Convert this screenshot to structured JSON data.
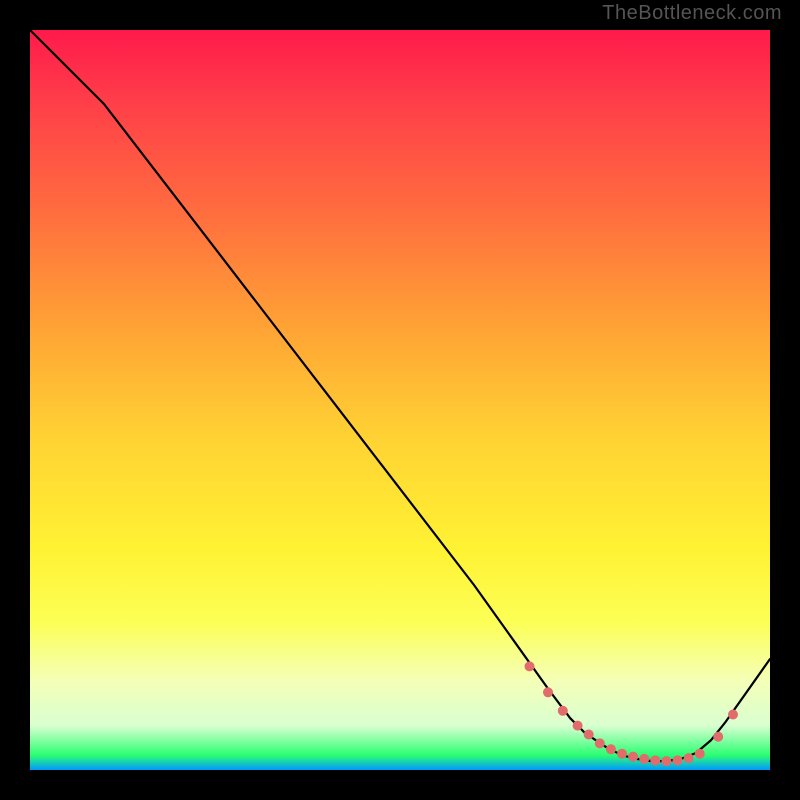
{
  "watermark": "TheBottleneck.com",
  "chart_data": {
    "type": "line",
    "title": "",
    "xlabel": "",
    "ylabel": "",
    "xlim": [
      0,
      100
    ],
    "ylim": [
      0,
      100
    ],
    "curve": {
      "x": [
        0,
        3,
        10,
        20,
        30,
        40,
        50,
        60,
        65,
        70,
        73,
        75,
        78,
        80,
        82,
        84,
        86,
        88,
        90,
        92,
        94,
        100
      ],
      "y": [
        100,
        97,
        90,
        77,
        64,
        51,
        38,
        25,
        18,
        11,
        7,
        5,
        3,
        2,
        1.5,
        1.2,
        1.2,
        1.5,
        2.3,
        4,
        6.5,
        15
      ]
    },
    "markers": {
      "x": [
        67.5,
        70,
        72,
        74,
        75.5,
        77,
        78.5,
        80,
        81.5,
        83,
        84.5,
        86,
        87.5,
        89,
        90.5,
        93,
        95
      ],
      "y": [
        14,
        10.5,
        8,
        6,
        4.8,
        3.6,
        2.8,
        2.2,
        1.8,
        1.5,
        1.3,
        1.2,
        1.3,
        1.6,
        2.2,
        4.5,
        7.5
      ]
    },
    "grid": false,
    "legend": false
  },
  "colors": {
    "curve": "#000000",
    "marker": "#e26b6b",
    "background_top": "#ff1a4b",
    "background_bottom": "#0099ff"
  }
}
